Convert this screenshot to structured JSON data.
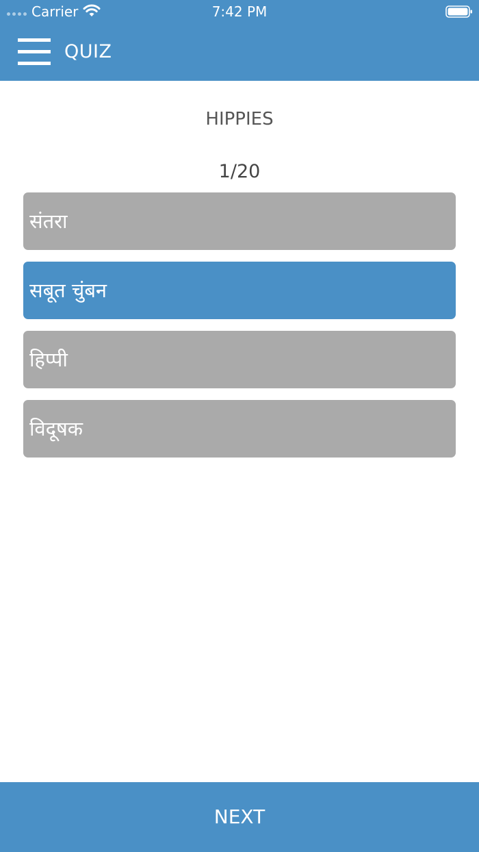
{
  "status_bar": {
    "carrier": "Carrier",
    "time": "7:42 PM"
  },
  "nav": {
    "title": "QUIZ",
    "menu_icon": "hamburger-menu-icon"
  },
  "quiz": {
    "word": "HIPPIES",
    "progress": "1/20",
    "options": [
      {
        "label": "संतरा",
        "selected": false
      },
      {
        "label": "सबूत चुंबन",
        "selected": true
      },
      {
        "label": "हिप्पी",
        "selected": false
      },
      {
        "label": "विदूषक",
        "selected": false
      }
    ]
  },
  "footer": {
    "next_label": "NEXT"
  },
  "colors": {
    "accent": "#4A90C6",
    "option_default": "#AAAAAA",
    "text_muted": "#555555"
  }
}
